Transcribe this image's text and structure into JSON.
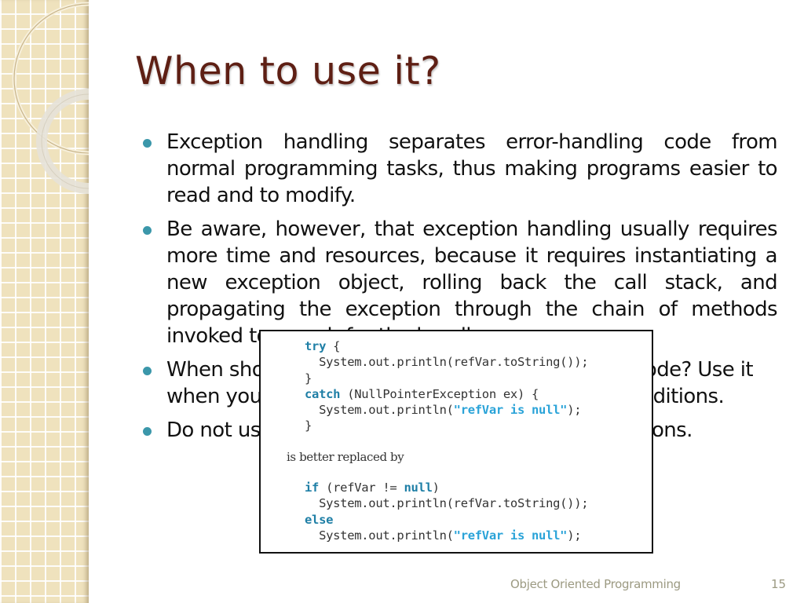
{
  "slide": {
    "title": "When to use it?",
    "bullets": [
      {
        "text": "Exception handling separates error-handling code from normal programming tasks, thus making programs easier to read and to modify."
      },
      {
        "text": "Be aware, however, that exception handling usually requires more time and resources, because it requires instantiating a new exception object, rolling back the call stack, and propagating the exception through the chain of methods invoked to search for the handler."
      },
      {
        "text": "When should you use the try-catch block in the code? Use it when you have to deal with unexpected error conditions."
      },
      {
        "text": "Do not use it to deal with simple, expected situations."
      }
    ],
    "bullet_color": "#3b97aa",
    "title_color": "#5e1f14"
  },
  "code_box": {
    "top_code": {
      "l1_kw": "try",
      "l1_rest": " {",
      "l2": "  System.out.println(refVar.toString());",
      "l3": "}",
      "l4_kw": "catch",
      "l4_rest": " (NullPointerException ex) {",
      "l5_pre": "  System.out.println(",
      "l5_str": "\"refVar is null\"",
      "l5_post": ");",
      "l6": "}"
    },
    "caption": "is better replaced by",
    "bottom_code": {
      "l1_kw": "if",
      "l1_mid": " (refVar != ",
      "l1_kw2": "null",
      "l1_post": ")",
      "l2": "  System.out.println(refVar.toString());",
      "l3_kw": "else",
      "l4_pre": "  System.out.println(",
      "l4_str": "\"refVar is null\"",
      "l4_post": ");"
    }
  },
  "footer": {
    "course": "Object Oriented Programming",
    "page_number": "15"
  }
}
